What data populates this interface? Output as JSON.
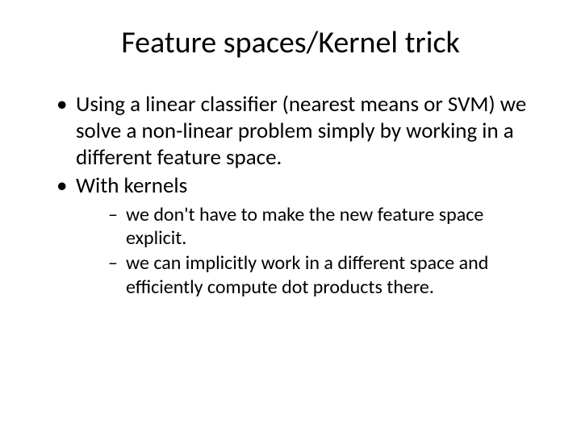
{
  "slide": {
    "title": "Feature spaces/Kernel trick",
    "bullets": [
      {
        "text": "Using a linear classifier (nearest means or SVM) we solve a non-linear problem simply by working in a different feature space."
      },
      {
        "text": "With kernels",
        "sub": [
          "we don't have to make the new feature space explicit.",
          "we can implicitly work in a different space and efficiently compute dot products there."
        ]
      }
    ]
  }
}
